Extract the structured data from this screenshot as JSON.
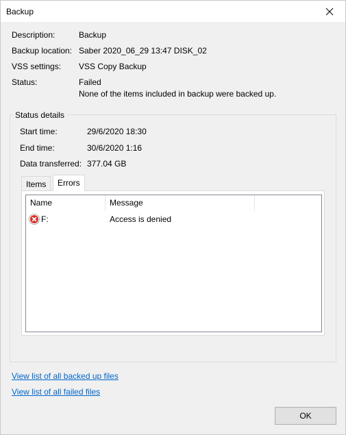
{
  "window": {
    "title": "Backup"
  },
  "summary": {
    "description_label": "Description:",
    "description_value": "Backup",
    "location_label": "Backup location:",
    "location_value": "Saber 2020_06_29 13:47 DISK_02",
    "vss_label": "VSS settings:",
    "vss_value": "VSS Copy Backup",
    "status_label": "Status:",
    "status_value": "Failed",
    "status_message": "None of the items included in backup were backed up."
  },
  "status_details": {
    "legend": "Status details",
    "start_label": "Start time:",
    "start_value": "29/6/2020 18:30",
    "end_label": "End time:",
    "end_value": "30/6/2020 1:16",
    "transferred_label": "Data transferred:",
    "transferred_value": "377.04 GB",
    "tabs": [
      {
        "label": "Items",
        "active": false
      },
      {
        "label": "Errors",
        "active": true
      }
    ],
    "columns": [
      "Name",
      "Message"
    ],
    "rows": [
      {
        "icon": "error-icon",
        "name": "F:",
        "message": "Access is denied"
      }
    ]
  },
  "links": {
    "backed_up": "View list of all backed up files",
    "failed": "View list of all failed files"
  },
  "buttons": {
    "ok": "OK"
  },
  "colors": {
    "link": "#0066cc",
    "error_red": "#d9302b"
  }
}
